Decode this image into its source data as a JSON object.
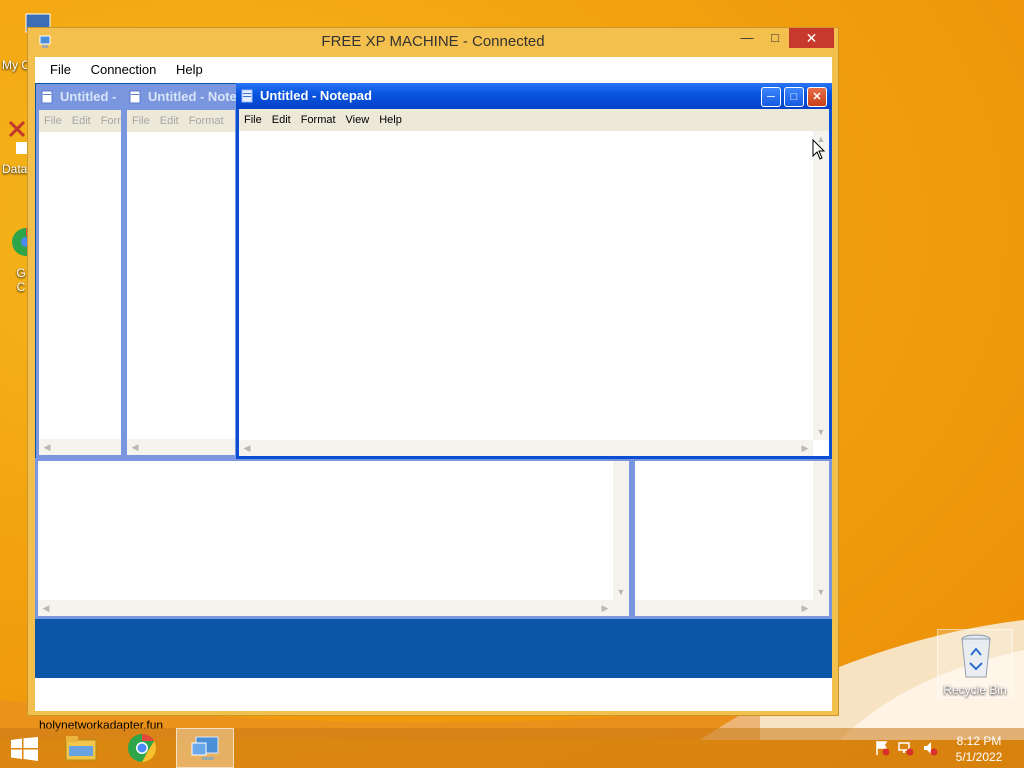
{
  "outer_window": {
    "title": "FREE XP MACHINE - Connected",
    "menu": [
      "File",
      "Connection",
      "Help"
    ],
    "status_text": "holynetworkadapter.fun"
  },
  "xp_windows": {
    "win1": {
      "title": "Untitled -",
      "menu": [
        "File",
        "Edit",
        "Form"
      ]
    },
    "win2": {
      "title": "Untitled - Note",
      "menu": [
        "File",
        "Edit",
        "Format"
      ]
    },
    "active": {
      "title": "Untitled - Notepad",
      "menu": [
        "File",
        "Edit",
        "Format",
        "View",
        "Help"
      ]
    }
  },
  "desktop": {
    "icons": [
      {
        "name": "My C",
        "icon": "computer-icon"
      },
      {
        "name": "Data",
        "icon": "database-icon"
      },
      {
        "name": "G C",
        "icon": "chrome-icon"
      }
    ],
    "recycle_bin": "Recycle Bin"
  },
  "taskbar": {
    "apps": [
      "start-icon",
      "file-explorer-icon",
      "chrome-icon",
      "remote-desktop-icon"
    ],
    "clock_time": "8:12 PM",
    "clock_date": "5/1/2022"
  },
  "colors": {
    "wallpaper": "#f2a20f",
    "xp_active_title": "#0a55e0",
    "xp_inactive_title": "#7a96df",
    "rdp_background": "#0a55a5"
  }
}
